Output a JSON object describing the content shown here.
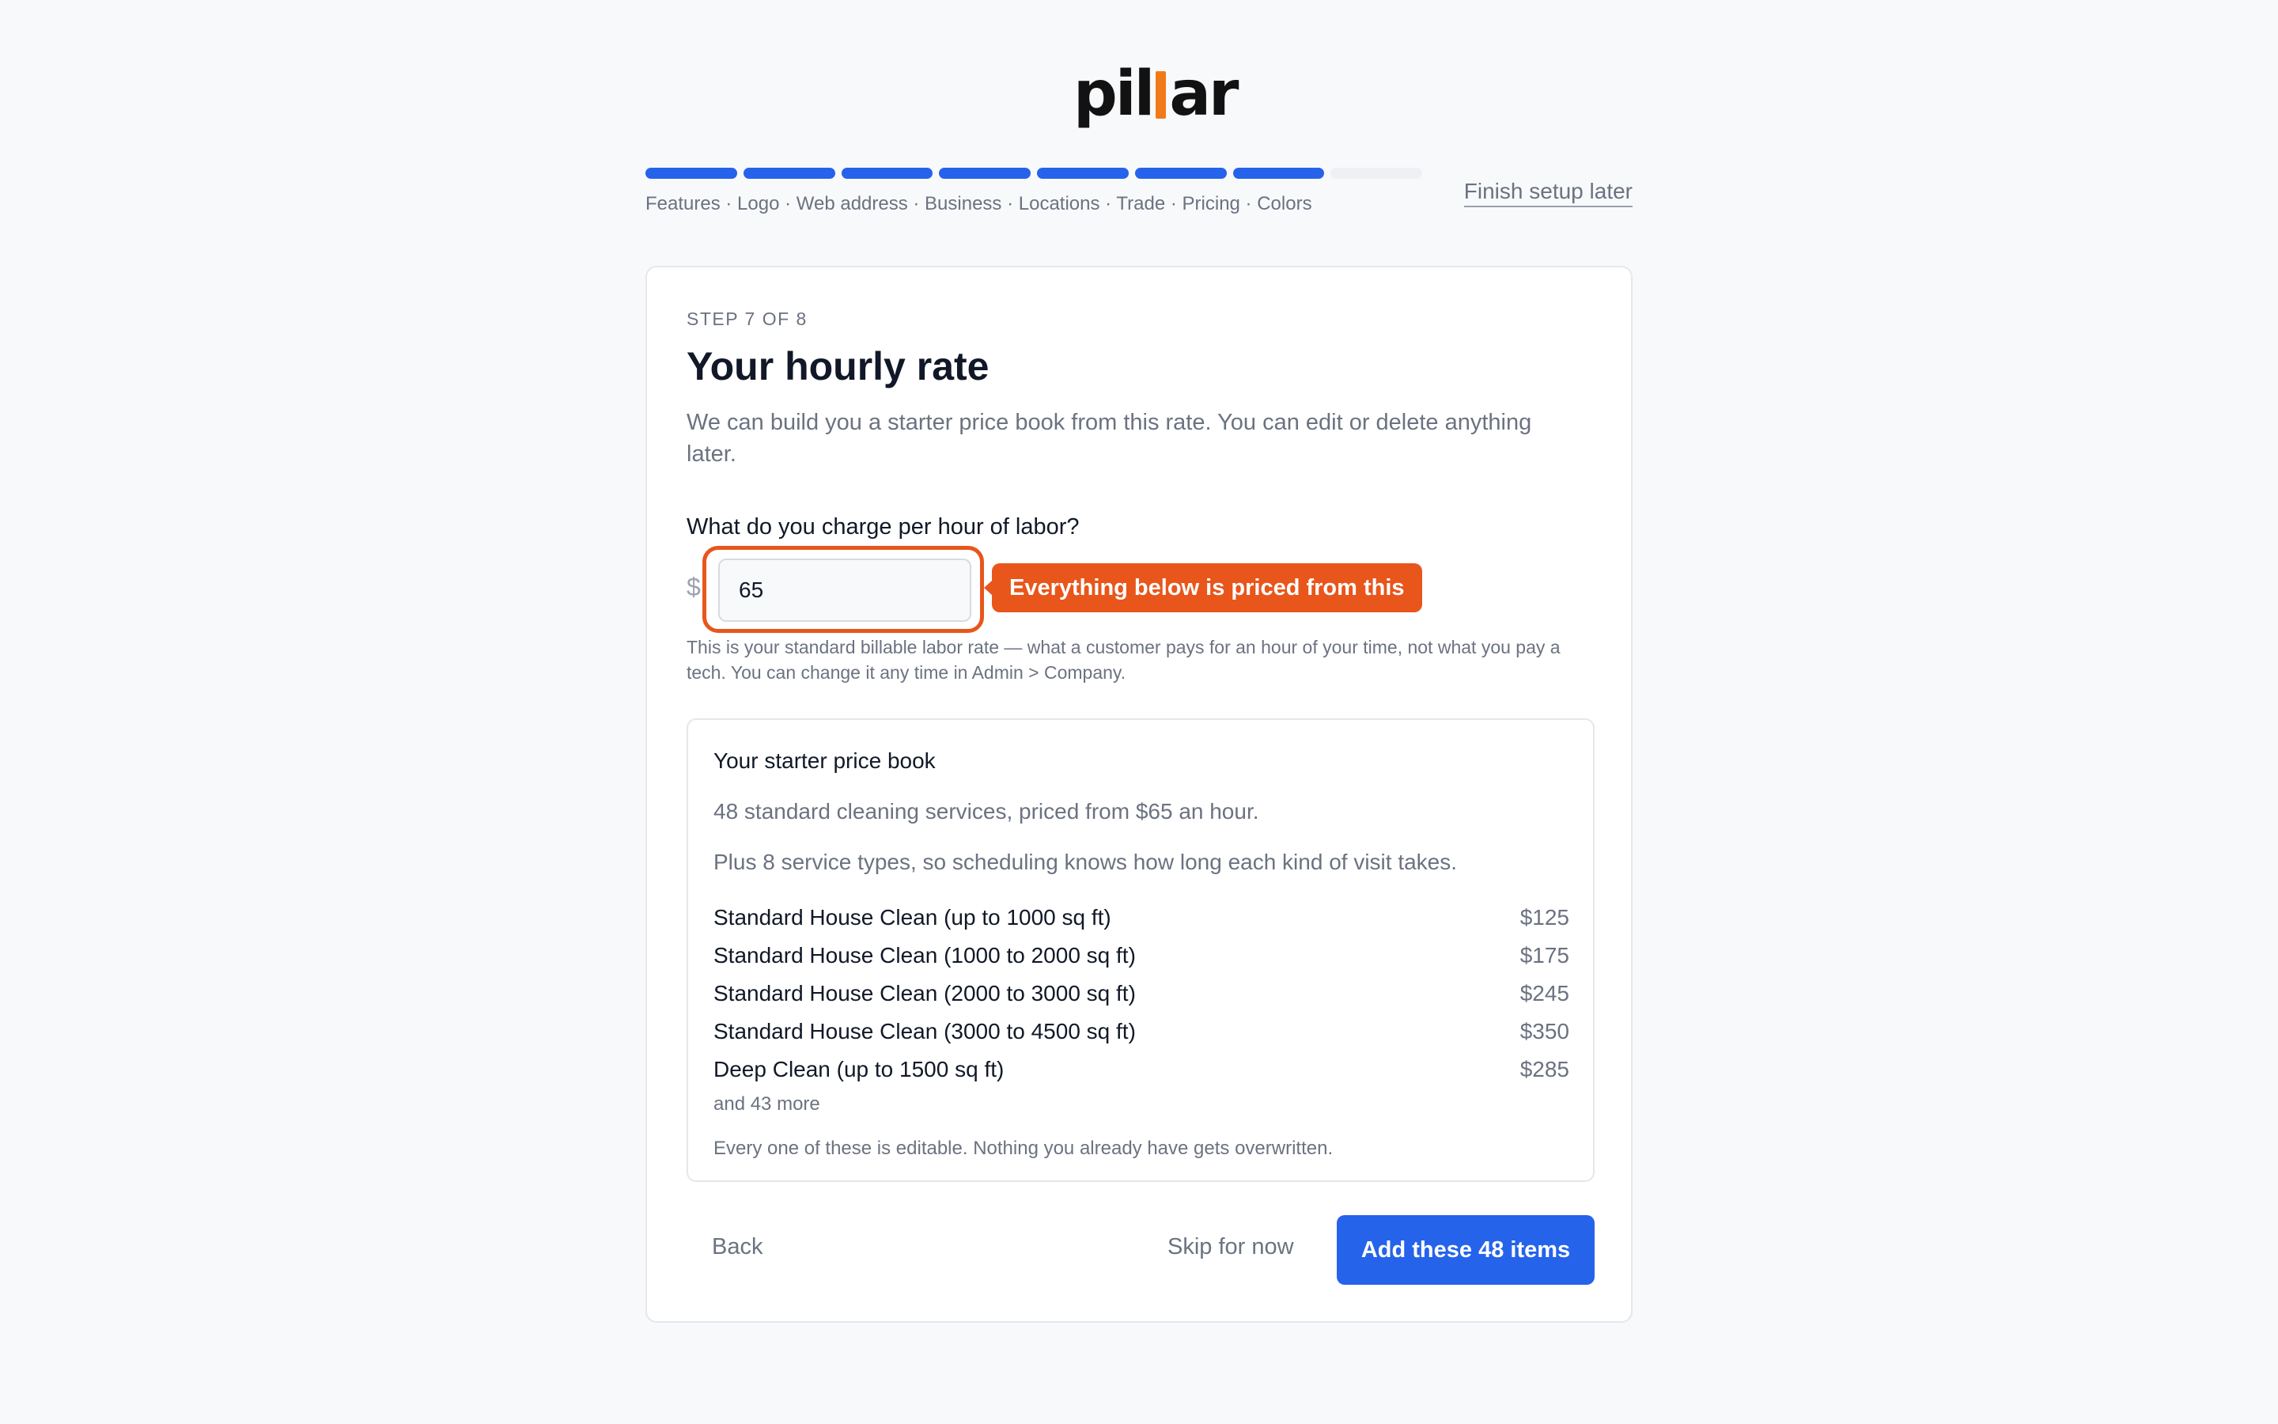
{
  "brand": {
    "logo_left": "pil",
    "logo_right": "ar"
  },
  "progress": {
    "total_steps": 8,
    "completed_steps": 7,
    "steps_label": "Features · Logo · Web address · Business · Locations · Trade · Pricing · Colors",
    "finish_later": "Finish setup later"
  },
  "card": {
    "step_eyebrow": "STEP 7 OF 8",
    "title": "Your hourly rate",
    "subtitle": "We can build you a starter price book from this rate. You can edit or delete anything later.",
    "question": "What do you charge per hour of labor?",
    "currency_symbol": "$",
    "rate_value": "65",
    "callout": "Everything below is priced from this",
    "helper": "This is your standard billable labor rate — what a customer pays for an hour of your time, not what you pay a tech. You can change it any time in Admin > Company."
  },
  "pricebook": {
    "title": "Your starter price book",
    "line1": "48 standard cleaning services, priced from $65 an hour.",
    "line2": "Plus 8 service types, so scheduling knows how long each kind of visit takes.",
    "items": [
      {
        "name": "Standard House Clean (up to 1000 sq ft)",
        "price": "$125"
      },
      {
        "name": "Standard House Clean (1000 to 2000 sq ft)",
        "price": "$175"
      },
      {
        "name": "Standard House Clean (2000 to 3000 sq ft)",
        "price": "$245"
      },
      {
        "name": "Standard House Clean (3000 to 4500 sq ft)",
        "price": "$350"
      },
      {
        "name": "Deep Clean (up to 1500 sq ft)",
        "price": "$285"
      }
    ],
    "more": "and 43 more",
    "note": "Every one of these is editable. Nothing you already have gets overwritten."
  },
  "actions": {
    "back": "Back",
    "skip": "Skip for now",
    "primary": "Add these 48 items"
  },
  "colors": {
    "accent_blue": "#2563eb",
    "highlight_orange": "#e8561b",
    "logo_orange": "#f07a1a"
  }
}
